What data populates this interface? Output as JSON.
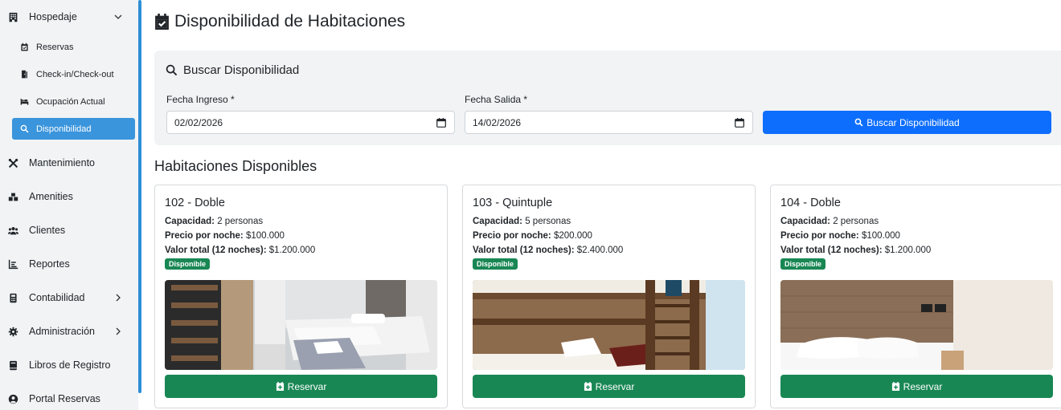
{
  "sidebar": {
    "hospedaje": "Hospedaje",
    "sub_items": [
      {
        "label": "Reservas"
      },
      {
        "label": "Check-in/Check-out"
      },
      {
        "label": "Ocupación Actual"
      },
      {
        "label": "Disponibilidad"
      }
    ],
    "items": [
      {
        "label": "Mantenimiento"
      },
      {
        "label": "Amenities"
      },
      {
        "label": "Clientes"
      },
      {
        "label": "Reportes"
      },
      {
        "label": "Contabilidad"
      },
      {
        "label": "Administración"
      },
      {
        "label": "Libros de Registro"
      },
      {
        "label": "Portal Reservas"
      }
    ]
  },
  "page": {
    "title": "Disponibilidad de Habitaciones"
  },
  "search": {
    "title": "Buscar Disponibilidad",
    "checkin_label": "Fecha Ingreso *",
    "checkin_value": "02/02/2026",
    "checkout_label": "Fecha Salida *",
    "checkout_value": "14/02/2026",
    "button_label": "Buscar Disponibilidad"
  },
  "results": {
    "title": "Habitaciones Disponibles",
    "capacity_label": "Capacidad:",
    "price_label": "Precio por noche:",
    "total_label": "Valor total (12 noches):",
    "reserve_label": "Reservar",
    "rooms": [
      {
        "name": "102 - Doble",
        "capacity": "2 personas",
        "price": "$100.000",
        "total": "$1.200.000",
        "status": "Disponible"
      },
      {
        "name": "103 - Quintuple",
        "capacity": "5 personas",
        "price": "$200.000",
        "total": "$2.400.000",
        "status": "Disponible"
      },
      {
        "name": "104 - Doble",
        "capacity": "2 personas",
        "price": "$100.000",
        "total": "$1.200.000",
        "status": "Disponible"
      }
    ]
  },
  "colors": {
    "primary": "#0d6efd",
    "success": "#198754",
    "sidebar_active": "#3b95dc",
    "panel_bg": "#f1f3f5"
  },
  "icons": {
    "hospedaje": "building-icon",
    "reservas": "calendar-check-icon",
    "checkin": "door-icon",
    "ocupacion": "bed-icon",
    "disponibilidad": "search-icon",
    "mantenimiento": "tools-icon",
    "amenities": "boxes-icon",
    "clientes": "users-icon",
    "reportes": "chart-icon",
    "contabilidad": "calculator-icon",
    "administracion": "gear-icon",
    "libros": "book-icon",
    "portal": "user-circle-icon"
  }
}
